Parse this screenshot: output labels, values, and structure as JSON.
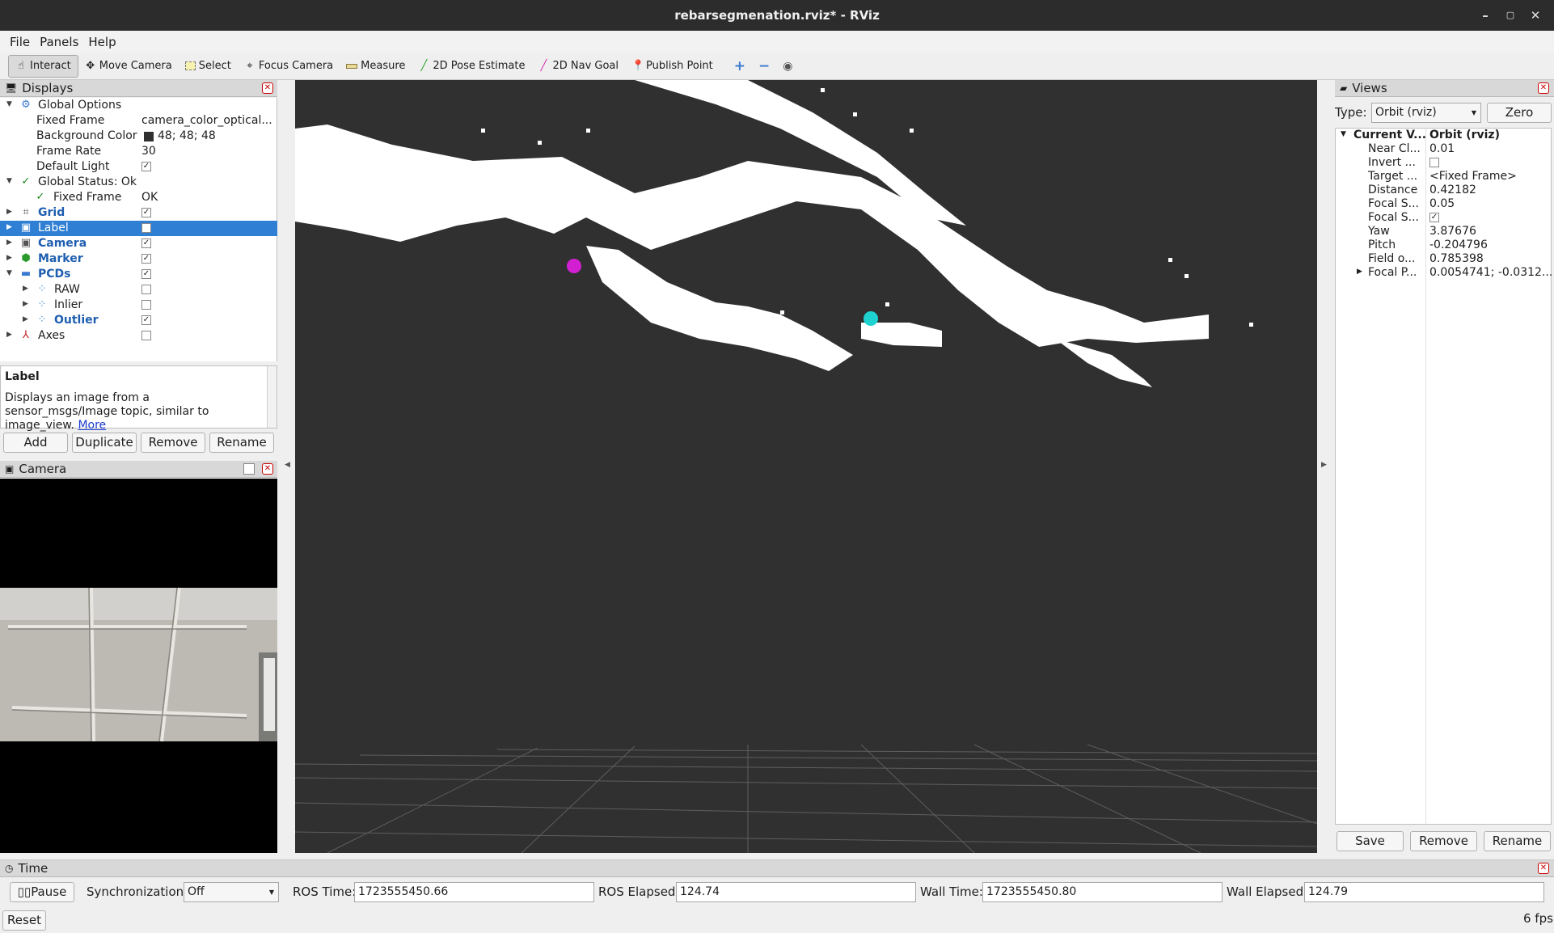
{
  "window": {
    "title": "rebarsegmenation.rviz* - RViz"
  },
  "menu": [
    "File",
    "Panels",
    "Help"
  ],
  "toolbar": [
    {
      "label": "Interact",
      "icon": "hand-icon"
    },
    {
      "label": "Move Camera",
      "icon": "move-icon"
    },
    {
      "label": "Select",
      "icon": "select-icon"
    },
    {
      "label": "Focus Camera",
      "icon": "focus-icon"
    },
    {
      "label": "Measure",
      "icon": "ruler-icon"
    },
    {
      "label": "2D Pose Estimate",
      "icon": "arrow-green-icon"
    },
    {
      "label": "2D Nav Goal",
      "icon": "arrow-pink-icon"
    },
    {
      "label": "Publish Point",
      "icon": "pin-icon"
    }
  ],
  "displays": {
    "title": "Displays",
    "rows": [
      {
        "name": "Global Options",
        "value": ""
      },
      {
        "name": "Fixed Frame",
        "value": "camera_color_optical..."
      },
      {
        "name": "Background Color",
        "value": "48; 48; 48"
      },
      {
        "name": "Frame Rate",
        "value": "30"
      },
      {
        "name": "Default Light",
        "value": ""
      },
      {
        "name": "Global Status: Ok",
        "value": ""
      },
      {
        "name": "Fixed Frame",
        "value": "OK"
      },
      {
        "name": "Grid",
        "value": ""
      },
      {
        "name": "Label",
        "value": ""
      },
      {
        "name": "Camera",
        "value": ""
      },
      {
        "name": "Marker",
        "value": ""
      },
      {
        "name": "PCDs",
        "value": ""
      },
      {
        "name": "RAW",
        "value": ""
      },
      {
        "name": "Inlier",
        "value": ""
      },
      {
        "name": "Outlier",
        "value": ""
      },
      {
        "name": "Axes",
        "value": ""
      }
    ],
    "desc_title": "Label",
    "desc_text": "Displays an image from a sensor_msgs/Image topic, similar to image_view.",
    "desc_link": "More",
    "buttons": [
      "Add",
      "Duplicate",
      "Remove",
      "Rename"
    ]
  },
  "camera_panel": {
    "title": "Camera"
  },
  "views": {
    "title": "Views",
    "type_label": "Type:",
    "type_value": "Orbit (rviz)",
    "zero": "Zero",
    "props": [
      {
        "name": "Current V...",
        "value": "Orbit (rviz)"
      },
      {
        "name": "Near Cl...",
        "value": "0.01"
      },
      {
        "name": "Invert ...",
        "value": ""
      },
      {
        "name": "Target ...",
        "value": "<Fixed Frame>"
      },
      {
        "name": "Distance",
        "value": "0.42182"
      },
      {
        "name": "Focal S...",
        "value": "0.05"
      },
      {
        "name": "Focal S...",
        "value": ""
      },
      {
        "name": "Yaw",
        "value": "3.87676"
      },
      {
        "name": "Pitch",
        "value": "-0.204796"
      },
      {
        "name": "Field o...",
        "value": "0.785398"
      },
      {
        "name": "Focal P...",
        "value": "0.0054741; -0.0312..."
      }
    ],
    "buttons": [
      "Save",
      "Remove",
      "Rename"
    ]
  },
  "time": {
    "title": "Time",
    "pause": "Pause",
    "sync_label": "Synchronization:",
    "sync_value": "Off",
    "ros_time_label": "ROS Time:",
    "ros_time": "1723555450.66",
    "ros_elapsed_label": "ROS Elapsed:",
    "ros_elapsed": "124.74",
    "wall_time_label": "Wall Time:",
    "wall_time": "1723555450.80",
    "wall_elapsed_label": "Wall Elapsed:",
    "wall_elapsed": "124.79",
    "reset": "Reset",
    "fps": "6 fps"
  }
}
